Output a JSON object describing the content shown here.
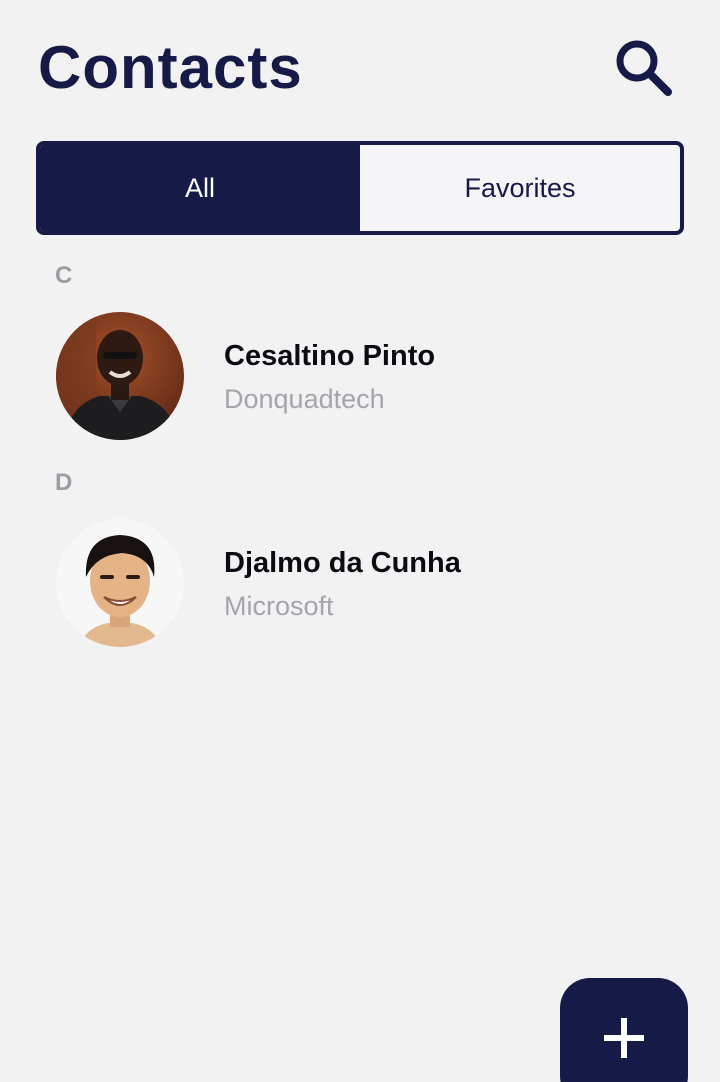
{
  "header": {
    "title": "Contacts",
    "search_icon": "search-icon"
  },
  "tabs": [
    {
      "label": "All",
      "active": true
    },
    {
      "label": "Favorites",
      "active": false
    }
  ],
  "sections": [
    {
      "letter": "C",
      "contacts": [
        {
          "name": "Cesaltino Pinto",
          "company": "Donquadtech",
          "avatar": "person-avatar"
        }
      ]
    },
    {
      "letter": "D",
      "contacts": [
        {
          "name": "Djalmo da Cunha",
          "company": "Microsoft",
          "avatar": "person-avatar"
        }
      ]
    }
  ],
  "fab": {
    "icon": "plus-icon"
  },
  "colors": {
    "primary": "#161a47",
    "background": "#f2f2f3",
    "muted": "#a4a4ab"
  }
}
